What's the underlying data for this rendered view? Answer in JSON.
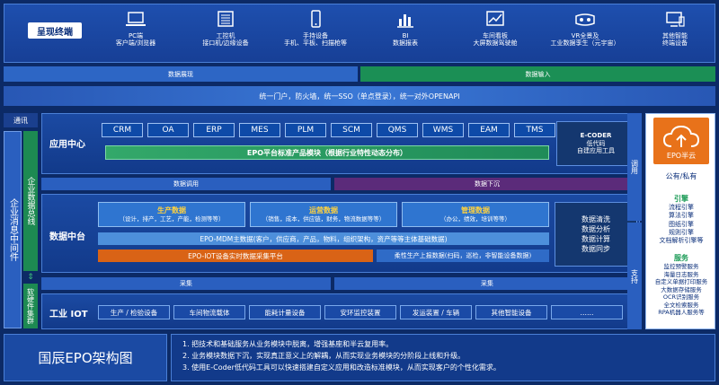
{
  "presentation": {
    "label": "呈现终端",
    "terminals": [
      {
        "icon": "laptop-icon",
        "title": "PC端",
        "sub": "客户端/浏览器"
      },
      {
        "icon": "industrial-pc-icon",
        "title": "工控机",
        "sub": "接口机/边缘设备"
      },
      {
        "icon": "handheld-icon",
        "title": "手持设备",
        "sub": "手机、平板、扫描枪等"
      },
      {
        "icon": "bar-chart-icon",
        "title": "BI",
        "sub": "数据报表"
      },
      {
        "icon": "dashboard-icon",
        "title": "车间看板",
        "sub": "大屏数据驾驶舱"
      },
      {
        "icon": "vr-icon",
        "title": "VR全景及",
        "sub": "工业数据孪生（元宇宙）"
      },
      {
        "icon": "smart-terminal-icon",
        "title": "其他智能",
        "sub": "终端设备"
      }
    ]
  },
  "bars": {
    "display": "数据展现",
    "input": "数据输入",
    "portal": "统一门户，防火墙，统一SSO（单点登录），统一对外OPENAPI"
  },
  "left": {
    "comm": "通讯",
    "bus": "企业消息中间件",
    "data_bus": "企业数据总线",
    "hw": "软硬件集群"
  },
  "app": {
    "title": "应用中心",
    "apps": [
      "CRM",
      "OA",
      "ERP",
      "MES",
      "PLM",
      "SCM",
      "QMS",
      "WMS",
      "EAM",
      "TMS"
    ],
    "epo_module": "EPO平台标准产品模块（根据行业特性动态分布）",
    "ecoder": [
      "E-CODER",
      "低代码",
      "自建应用工具"
    ]
  },
  "mid_bars": {
    "call": "数据调用",
    "sink": "数据下沉",
    "collect1": "采集",
    "collect2": "采集"
  },
  "data": {
    "title": "数据中台",
    "groups": [
      {
        "name": "生产数据",
        "desc": "（设计，排产，工艺，产能，检测等等）"
      },
      {
        "name": "运营数据",
        "desc": "（销售，成本，供应链，财务，物流数据等等）"
      },
      {
        "name": "管理数据",
        "desc": "（办公，绩效，培训等等）"
      }
    ],
    "mdm": "EPO-MDM主数据(客户，供应商，产品，物料，组织架构，资产等等主体基础数据)",
    "iot": "EPO-IOT设备实时数据采集平台",
    "flex": "柔性生产上报数据(扫码，巡检，非智能设备数据)",
    "ops": [
      "数据清洗",
      "数据分析",
      "数据计算",
      "数据同步"
    ]
  },
  "iot": {
    "title": "工业 IOT",
    "items": [
      "生产 / 检验设备",
      "车间物流载体",
      "能耗计量设备",
      "安环监控装置",
      "发运装置 / 车辆",
      "其他智能设备",
      "……"
    ]
  },
  "right": {
    "call": "调用",
    "support": "支持",
    "cloud": "EPO半云",
    "deploy": "公有/私有",
    "engine_title": "引擎",
    "engines": [
      "流程引擎",
      "算法引擎",
      "图纸引擎",
      "规则引擎",
      "文档解析引擎等"
    ],
    "service_title": "服务",
    "services": [
      "监控预警服务",
      "海量日志服务",
      "自定义单据打印服务",
      "大数据存储服务",
      "OCR识别服务",
      "全文检索服务",
      "RPA机器人服务等"
    ]
  },
  "footer": {
    "title": "国辰EPO架构图",
    "notes": [
      "1.  把技术和基础服务从业务模块中脱离，增强基座和半云复用率。",
      "2.  业务模块数据下沉，实现真正意义上的解耦，从而实现业务模块的分阶段上线和升级。",
      "3.  使用E-Coder低代码工具可以快速搭建自定义应用和改造标准模块，从而实现客户的个性化需求。"
    ]
  },
  "colors": {
    "bg": "#0c2a66",
    "green": "#188c54",
    "orange": "#d96316",
    "purple": "#5b2b7a"
  }
}
